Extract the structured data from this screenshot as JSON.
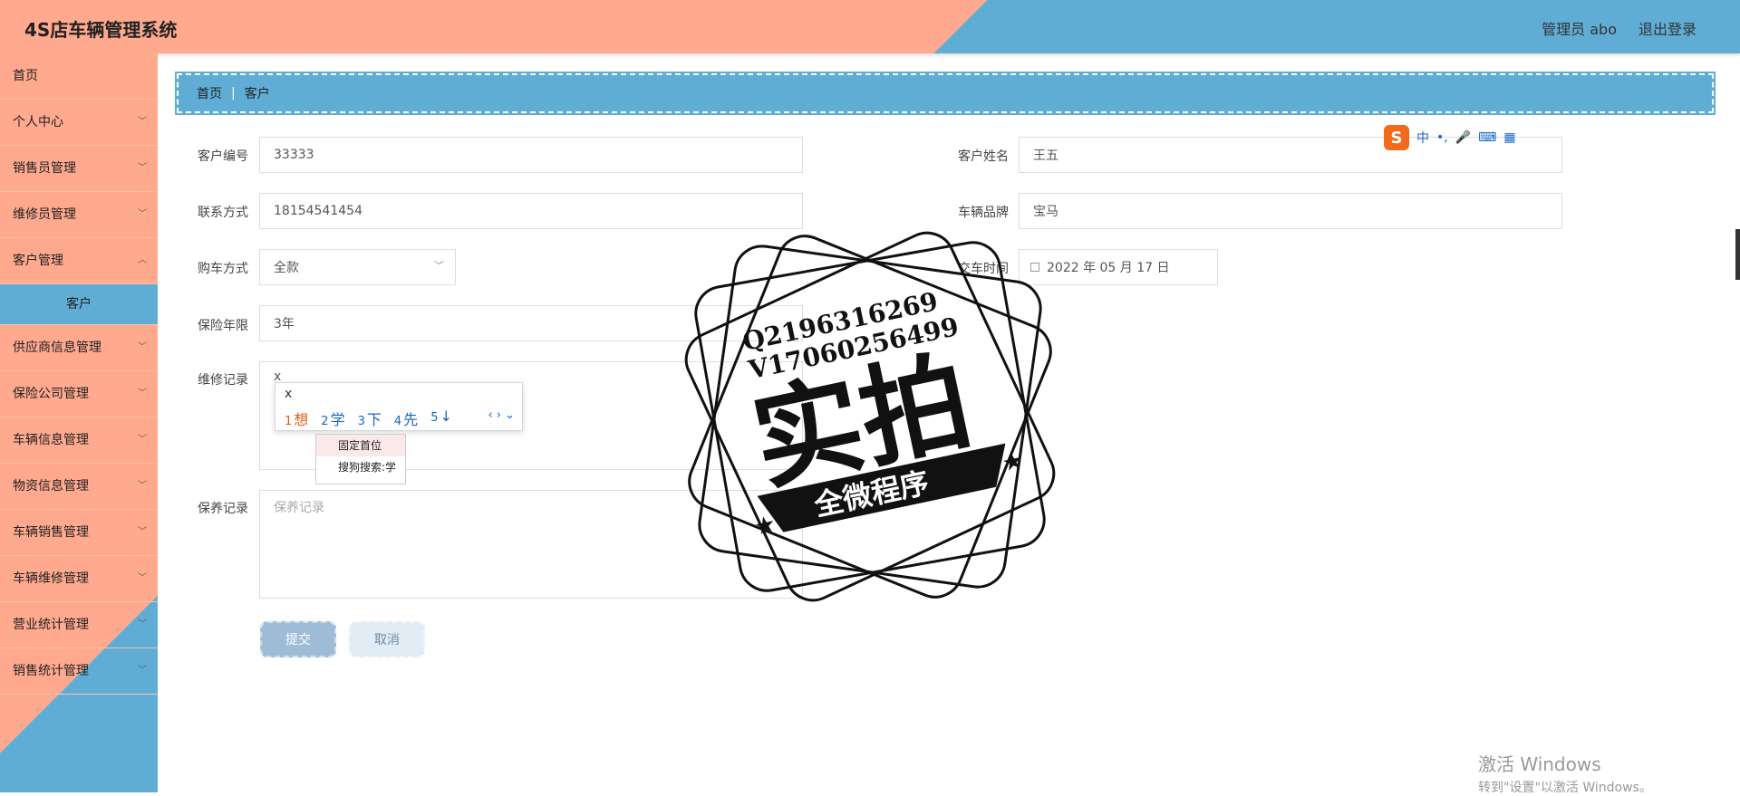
{
  "header": {
    "app_title": "4S店车辆管理系统",
    "user_label": "管理员 abo",
    "logout_label": "退出登录"
  },
  "sidebar": {
    "items": [
      {
        "label": "首页"
      },
      {
        "label": "个人中心"
      },
      {
        "label": "销售员管理"
      },
      {
        "label": "维修员管理"
      },
      {
        "label": "客户管理"
      },
      {
        "label": "客户"
      },
      {
        "label": "供应商信息管理"
      },
      {
        "label": "保险公司管理"
      },
      {
        "label": "车辆信息管理"
      },
      {
        "label": "物资信息管理"
      },
      {
        "label": "车辆销售管理"
      },
      {
        "label": "车辆维修管理"
      },
      {
        "label": "营业统计管理"
      },
      {
        "label": "销售统计管理"
      }
    ]
  },
  "breadcrumb": {
    "home": "首页",
    "separator": "|",
    "current": "客户"
  },
  "form": {
    "customer_id": {
      "label": "客户编号",
      "value": "33333"
    },
    "customer_name": {
      "label": "客户姓名",
      "value": "王五"
    },
    "contact": {
      "label": "联系方式",
      "value": "18154541454"
    },
    "car_brand": {
      "label": "车辆品牌",
      "value": "宝马"
    },
    "purchase_method": {
      "label": "购车方式",
      "value": "全款"
    },
    "delivery_time": {
      "label": "交车时间",
      "value": "2022 年 05 月 17 日"
    },
    "insurance_years": {
      "label": "保险年限",
      "value": "3年"
    },
    "repair_record": {
      "label": "维修记录",
      "value": "x"
    },
    "maintenance_record": {
      "label": "保养记录",
      "placeholder": "保养记录"
    },
    "submit_label": "提交",
    "cancel_label": "取消"
  },
  "ime": {
    "logo": "S",
    "mode": "中",
    "punct": "•,",
    "input": "x",
    "candidates": [
      {
        "num": "1",
        "text": "想"
      },
      {
        "num": "2",
        "text": "学"
      },
      {
        "num": "3",
        "text": "下"
      },
      {
        "num": "4",
        "text": "先"
      },
      {
        "num": "5",
        "text": "↓"
      }
    ],
    "nav": "‹ › ⌄",
    "menu": [
      "固定首位",
      "搜狗搜索:学"
    ]
  },
  "watermark": {
    "line1": "Q2196316269",
    "line2": "V17060256499",
    "big": "实拍",
    "banner": "全微程序"
  },
  "windows_activation": {
    "title": "激活 Windows",
    "subtitle": "转到\"设置\"以激活 Windows。"
  }
}
